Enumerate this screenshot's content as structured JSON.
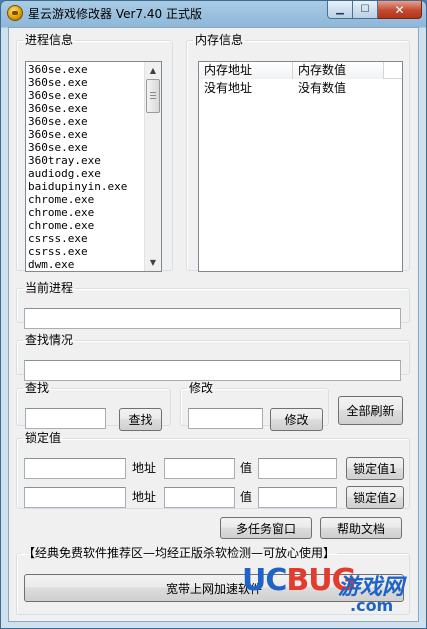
{
  "window": {
    "title": "星云游戏修改器 Ver7.40 正式版",
    "controls": {
      "minimize": "▁",
      "maximize": "☐",
      "close": "✕"
    }
  },
  "process_info": {
    "legend": "进程信息",
    "items": [
      "360se.exe",
      "360se.exe",
      "360se.exe",
      "360se.exe",
      "360se.exe",
      "360se.exe",
      "360se.exe",
      "360tray.exe",
      "audiodg.exe",
      "baidupinyin.exe",
      "chrome.exe",
      "chrome.exe",
      "chrome.exe",
      "csrss.exe",
      "csrss.exe",
      "dwm.exe"
    ]
  },
  "memory_info": {
    "legend": "内存信息",
    "columns": [
      "内存地址",
      "内存数值"
    ],
    "rows": [
      [
        "没有地址",
        "没有数值"
      ]
    ]
  },
  "current_process": {
    "legend": "当前进程",
    "value": ""
  },
  "search_status": {
    "legend": "查找情况",
    "value": ""
  },
  "search": {
    "legend": "查找",
    "value": "",
    "button": "查找"
  },
  "modify": {
    "legend": "修改",
    "value": "",
    "button": "修改"
  },
  "refresh_all": {
    "button": "全部刷新"
  },
  "lock_values": {
    "legend": "锁定值",
    "address_label": "地址",
    "value_label": "值",
    "rows": [
      {
        "name": "",
        "address": "",
        "value": "",
        "button": "锁定值1"
      },
      {
        "name": "",
        "address": "",
        "value": "",
        "button": "锁定值2"
      }
    ]
  },
  "multi_task_window": {
    "button": "多任务窗口"
  },
  "help_doc": {
    "button": "帮助文档"
  },
  "recommend": {
    "legend": "【经典免费软件推荐区—均经正版杀软检测—可放心使用】",
    "button": "宽带上网加速软件"
  },
  "watermark": {
    "ucbug": "UCBUG",
    "uc": "UC",
    "bug": "BUG",
    "cn": "游戏网",
    "com": ".com"
  }
}
